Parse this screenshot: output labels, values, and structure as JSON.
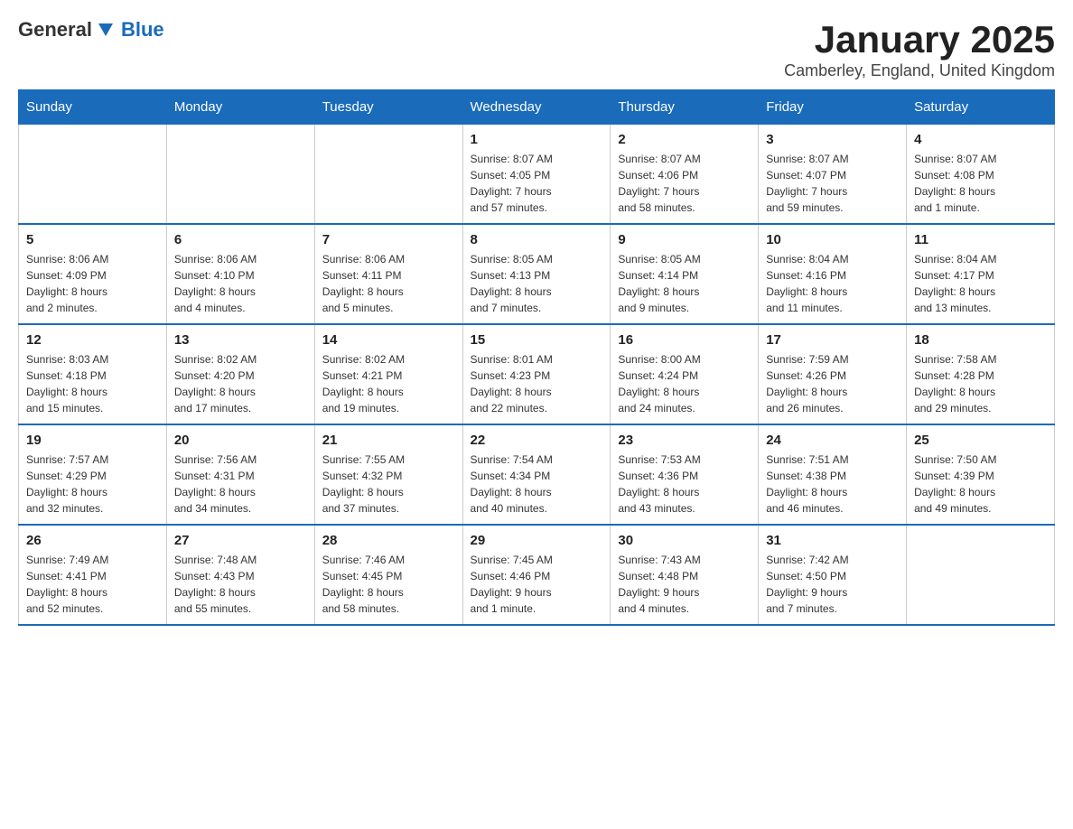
{
  "logo": {
    "general": "General",
    "blue": "Blue"
  },
  "title": "January 2025",
  "location": "Camberley, England, United Kingdom",
  "headers": [
    "Sunday",
    "Monday",
    "Tuesday",
    "Wednesday",
    "Thursday",
    "Friday",
    "Saturday"
  ],
  "weeks": [
    [
      {
        "day": "",
        "info": ""
      },
      {
        "day": "",
        "info": ""
      },
      {
        "day": "",
        "info": ""
      },
      {
        "day": "1",
        "info": "Sunrise: 8:07 AM\nSunset: 4:05 PM\nDaylight: 7 hours\nand 57 minutes."
      },
      {
        "day": "2",
        "info": "Sunrise: 8:07 AM\nSunset: 4:06 PM\nDaylight: 7 hours\nand 58 minutes."
      },
      {
        "day": "3",
        "info": "Sunrise: 8:07 AM\nSunset: 4:07 PM\nDaylight: 7 hours\nand 59 minutes."
      },
      {
        "day": "4",
        "info": "Sunrise: 8:07 AM\nSunset: 4:08 PM\nDaylight: 8 hours\nand 1 minute."
      }
    ],
    [
      {
        "day": "5",
        "info": "Sunrise: 8:06 AM\nSunset: 4:09 PM\nDaylight: 8 hours\nand 2 minutes."
      },
      {
        "day": "6",
        "info": "Sunrise: 8:06 AM\nSunset: 4:10 PM\nDaylight: 8 hours\nand 4 minutes."
      },
      {
        "day": "7",
        "info": "Sunrise: 8:06 AM\nSunset: 4:11 PM\nDaylight: 8 hours\nand 5 minutes."
      },
      {
        "day": "8",
        "info": "Sunrise: 8:05 AM\nSunset: 4:13 PM\nDaylight: 8 hours\nand 7 minutes."
      },
      {
        "day": "9",
        "info": "Sunrise: 8:05 AM\nSunset: 4:14 PM\nDaylight: 8 hours\nand 9 minutes."
      },
      {
        "day": "10",
        "info": "Sunrise: 8:04 AM\nSunset: 4:16 PM\nDaylight: 8 hours\nand 11 minutes."
      },
      {
        "day": "11",
        "info": "Sunrise: 8:04 AM\nSunset: 4:17 PM\nDaylight: 8 hours\nand 13 minutes."
      }
    ],
    [
      {
        "day": "12",
        "info": "Sunrise: 8:03 AM\nSunset: 4:18 PM\nDaylight: 8 hours\nand 15 minutes."
      },
      {
        "day": "13",
        "info": "Sunrise: 8:02 AM\nSunset: 4:20 PM\nDaylight: 8 hours\nand 17 minutes."
      },
      {
        "day": "14",
        "info": "Sunrise: 8:02 AM\nSunset: 4:21 PM\nDaylight: 8 hours\nand 19 minutes."
      },
      {
        "day": "15",
        "info": "Sunrise: 8:01 AM\nSunset: 4:23 PM\nDaylight: 8 hours\nand 22 minutes."
      },
      {
        "day": "16",
        "info": "Sunrise: 8:00 AM\nSunset: 4:24 PM\nDaylight: 8 hours\nand 24 minutes."
      },
      {
        "day": "17",
        "info": "Sunrise: 7:59 AM\nSunset: 4:26 PM\nDaylight: 8 hours\nand 26 minutes."
      },
      {
        "day": "18",
        "info": "Sunrise: 7:58 AM\nSunset: 4:28 PM\nDaylight: 8 hours\nand 29 minutes."
      }
    ],
    [
      {
        "day": "19",
        "info": "Sunrise: 7:57 AM\nSunset: 4:29 PM\nDaylight: 8 hours\nand 32 minutes."
      },
      {
        "day": "20",
        "info": "Sunrise: 7:56 AM\nSunset: 4:31 PM\nDaylight: 8 hours\nand 34 minutes."
      },
      {
        "day": "21",
        "info": "Sunrise: 7:55 AM\nSunset: 4:32 PM\nDaylight: 8 hours\nand 37 minutes."
      },
      {
        "day": "22",
        "info": "Sunrise: 7:54 AM\nSunset: 4:34 PM\nDaylight: 8 hours\nand 40 minutes."
      },
      {
        "day": "23",
        "info": "Sunrise: 7:53 AM\nSunset: 4:36 PM\nDaylight: 8 hours\nand 43 minutes."
      },
      {
        "day": "24",
        "info": "Sunrise: 7:51 AM\nSunset: 4:38 PM\nDaylight: 8 hours\nand 46 minutes."
      },
      {
        "day": "25",
        "info": "Sunrise: 7:50 AM\nSunset: 4:39 PM\nDaylight: 8 hours\nand 49 minutes."
      }
    ],
    [
      {
        "day": "26",
        "info": "Sunrise: 7:49 AM\nSunset: 4:41 PM\nDaylight: 8 hours\nand 52 minutes."
      },
      {
        "day": "27",
        "info": "Sunrise: 7:48 AM\nSunset: 4:43 PM\nDaylight: 8 hours\nand 55 minutes."
      },
      {
        "day": "28",
        "info": "Sunrise: 7:46 AM\nSunset: 4:45 PM\nDaylight: 8 hours\nand 58 minutes."
      },
      {
        "day": "29",
        "info": "Sunrise: 7:45 AM\nSunset: 4:46 PM\nDaylight: 9 hours\nand 1 minute."
      },
      {
        "day": "30",
        "info": "Sunrise: 7:43 AM\nSunset: 4:48 PM\nDaylight: 9 hours\nand 4 minutes."
      },
      {
        "day": "31",
        "info": "Sunrise: 7:42 AM\nSunset: 4:50 PM\nDaylight: 9 hours\nand 7 minutes."
      },
      {
        "day": "",
        "info": ""
      }
    ]
  ]
}
